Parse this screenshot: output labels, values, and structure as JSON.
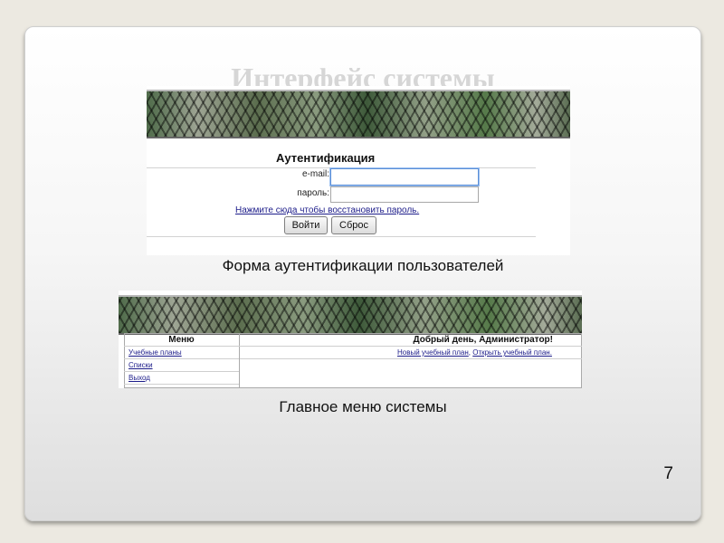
{
  "slide": {
    "title": "Интерфейс системы",
    "page_number": "7"
  },
  "auth_form": {
    "heading": "Аутентификация",
    "email_label": "e-mail:",
    "email_value": "",
    "password_label": "пароль:",
    "password_value": "",
    "recover_link": "Нажмите сюда чтобы восстановить пароль.",
    "login_button": "Войти",
    "reset_button": "Сброс",
    "caption": "Форма аутентификации пользователей"
  },
  "main_menu": {
    "menu_heading": "Меню",
    "greeting": "Добрый день, Администратор!",
    "items": [
      {
        "label": "Учебные планы"
      },
      {
        "label": "Списки"
      },
      {
        "label": "Выход"
      }
    ],
    "action_new": "Новый учебный план",
    "action_sep": ", ",
    "action_open": "Открыть учебный план.",
    "caption": "Главное меню системы"
  }
}
